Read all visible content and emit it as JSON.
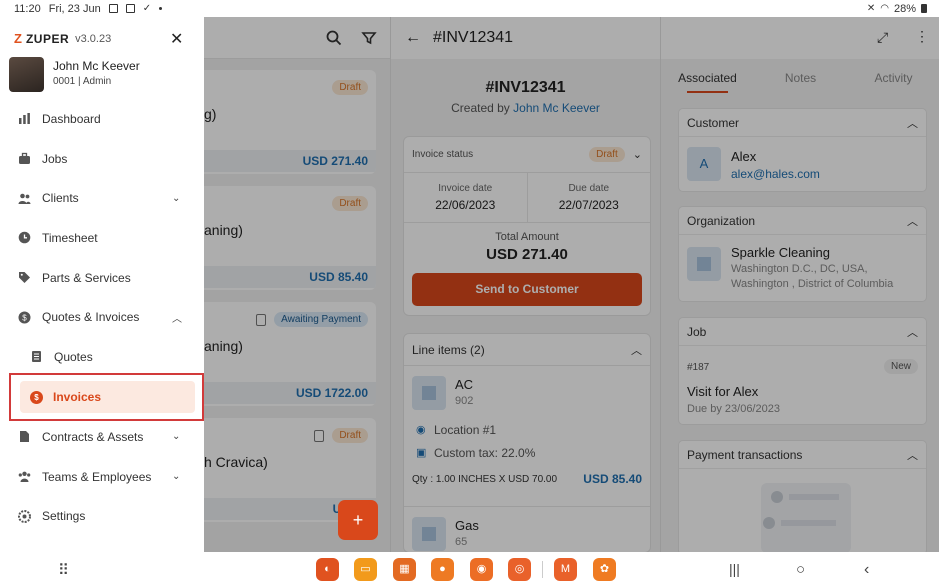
{
  "status_bar": {
    "time": "11:20",
    "date": "Fri, 23 Jun",
    "battery": "28%"
  },
  "drawer": {
    "brand": "ZUPER",
    "version": "v3.0.23",
    "user": {
      "name": "John Mc Keever",
      "role": "0001 | Admin"
    },
    "items": [
      {
        "label": "Dashboard",
        "icon": "bar-chart-icon"
      },
      {
        "label": "Jobs",
        "icon": "briefcase-icon"
      },
      {
        "label": "Clients",
        "icon": "users-icon",
        "expand": "down"
      },
      {
        "label": "Timesheet",
        "icon": "clock-icon"
      },
      {
        "label": "Parts & Services",
        "icon": "tag-icon"
      },
      {
        "label": "Quotes & Invoices",
        "icon": "dollar-icon",
        "expand": "up"
      },
      {
        "label": "Quotes",
        "icon": "document-icon",
        "sub": true
      }
    ],
    "selected": {
      "label": "Invoices",
      "icon": "dollar-icon"
    },
    "items_after": [
      {
        "label": "Contracts & Assets",
        "icon": "file-icon",
        "expand": "down"
      },
      {
        "label": "Teams & Employees",
        "icon": "team-icon",
        "expand": "down"
      },
      {
        "label": "Settings",
        "icon": "gear-icon"
      }
    ]
  },
  "list": {
    "cards": [
      {
        "name_fragment": "g)",
        "badge": "Draft",
        "amount": "USD 271.40"
      },
      {
        "name_fragment": "aning)",
        "badge": "Draft",
        "amount": "USD 85.40"
      },
      {
        "name_fragment": "aning)",
        "badge": "Awaiting Payment",
        "amount": "USD 1722.00"
      },
      {
        "name_fragment": "h Cravica)",
        "badge": "Draft",
        "amount": "USD 7"
      }
    ],
    "fab": "+"
  },
  "invoice": {
    "header": "#INV12341",
    "title": "#INV12341",
    "created_by_label": "Created by",
    "created_by": "John Mc Keever",
    "status_label": "Invoice status",
    "status": "Draft",
    "invoice_date_label": "Invoice date",
    "invoice_date": "22/06/2023",
    "due_date_label": "Due date",
    "due_date": "22/07/2023",
    "total_label": "Total Amount",
    "total": "USD 271.40",
    "send_button": "Send to Customer",
    "line_items_label": "Line items (2)",
    "line_items": [
      {
        "name": "AC",
        "code": "902",
        "location": "Location #1",
        "tax": "Custom tax: 22.0%",
        "qty": "Qty : 1.00 INCHES X USD 70.00",
        "amount": "USD 85.40"
      },
      {
        "name": "Gas",
        "code": "65"
      }
    ]
  },
  "related": {
    "tabs": [
      "Associated",
      "Notes",
      "Activity"
    ],
    "customer": {
      "title": "Customer",
      "initial": "A",
      "name": "Alex",
      "email": "alex@hales.com"
    },
    "organization": {
      "title": "Organization",
      "name": "Sparkle Cleaning",
      "address_line1": "Washington D.C., DC, USA,",
      "address_line2": "Washington , District of Columbia"
    },
    "job": {
      "title": "Job",
      "number": "#187",
      "badge": "New",
      "name": "Visit for Alex",
      "due": "Due by 23/06/2023"
    },
    "payments": {
      "title": "Payment transactions"
    }
  },
  "colors": {
    "accent": "#d9481b",
    "link": "#1f6fb0",
    "draft_bg": "#fbe7d3",
    "draft_text": "#d9772a"
  }
}
